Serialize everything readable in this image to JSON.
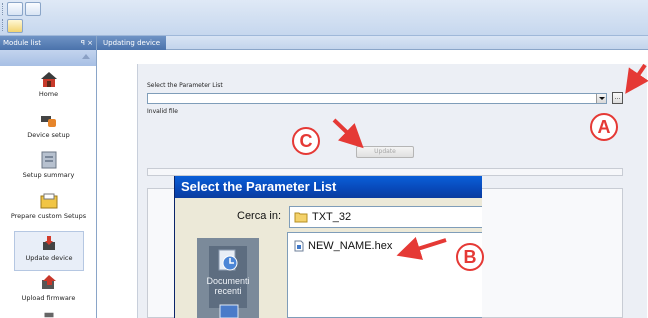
{
  "sidebar": {
    "title": "Module list",
    "controls": "p ×",
    "items": [
      {
        "label": "Home",
        "icon": "home-icon"
      },
      {
        "label": "Device setup",
        "icon": "device-setup-icon"
      },
      {
        "label": "Setup summary",
        "icon": "setup-summary-icon"
      },
      {
        "label": "Prepare custom Setups",
        "icon": "prepare-setups-icon"
      },
      {
        "label": "Update device",
        "icon": "update-device-icon"
      },
      {
        "label": "Upload firmware",
        "icon": "upload-firmware-icon"
      }
    ]
  },
  "main": {
    "tab": "Updating device",
    "select_label": "Select the Parameter List",
    "combo_value": "",
    "browse_label": "...",
    "invalid_text": "Invalid file",
    "update_label": "Update"
  },
  "dialog": {
    "title": "Select the Parameter List",
    "look_in_label": "Cerca in:",
    "look_in_value": "TXT_32",
    "places": [
      "Documenti recenti"
    ],
    "files": [
      "NEW_NAME.hex"
    ]
  },
  "callouts": {
    "a": "A",
    "b": "B",
    "c": "C"
  },
  "colors": {
    "accent": "#e53935",
    "title_bar": "#0848b8",
    "header": "#4a72ab"
  }
}
